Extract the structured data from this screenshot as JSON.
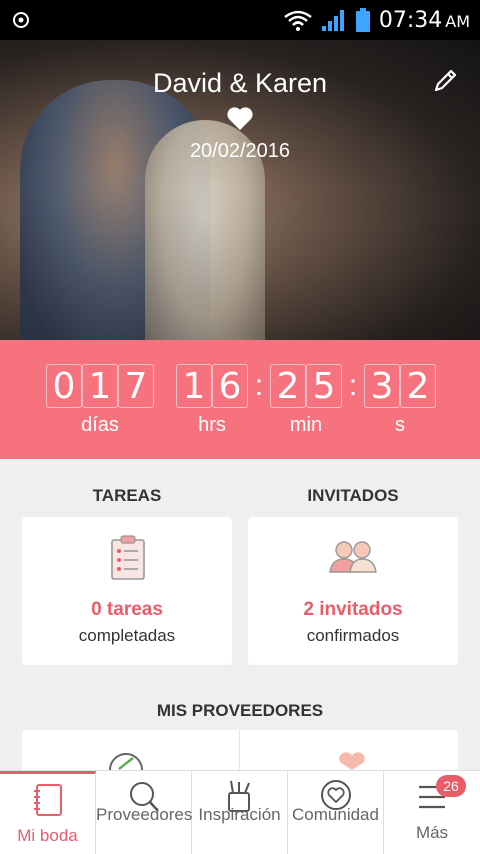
{
  "status_bar": {
    "time": "07:34",
    "ampm": "AM"
  },
  "hero": {
    "title": "David & Karen",
    "date": "20/02/2016"
  },
  "countdown": {
    "days": [
      "0",
      "1",
      "7"
    ],
    "hours": [
      "1",
      "6"
    ],
    "minutes": [
      "2",
      "5"
    ],
    "seconds": [
      "3",
      "2"
    ],
    "labels": {
      "days": "días",
      "hours": "hrs",
      "minutes": "min",
      "seconds": "s"
    }
  },
  "sections": {
    "tasks": {
      "title": "TAREAS",
      "count": "0 tareas",
      "sub": "completadas"
    },
    "guests": {
      "title": "INVITADOS",
      "count": "2 invitados",
      "sub": "confirmados"
    },
    "vendors": {
      "title": "MIS PROVEEDORES"
    }
  },
  "nav": [
    {
      "label": "Mi boda",
      "icon": "notebook-icon",
      "active": true
    },
    {
      "label": "Proveedores",
      "icon": "search-icon"
    },
    {
      "label": "Inspiración",
      "icon": "inspiration-icon"
    },
    {
      "label": "Comunidad",
      "icon": "community-icon"
    },
    {
      "label": "Más",
      "icon": "menu-icon",
      "badge": "26"
    }
  ],
  "colors": {
    "accent": "#f6727f",
    "accent_dark": "#e95d6a"
  }
}
